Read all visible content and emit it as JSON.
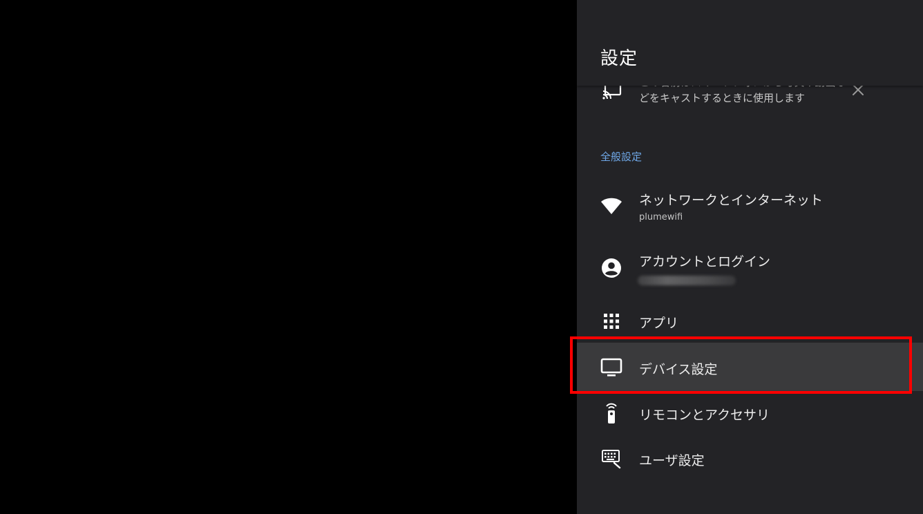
{
  "panel": {
    "title": "設定"
  },
  "cast_card": {
    "text": "この名前はスマートフォンから写真や動画などをキャストするときに使用します",
    "icon": "cast-icon",
    "close_icon": "close-icon"
  },
  "general_section": {
    "label": "全般設定"
  },
  "items": [
    {
      "label": "ネットワークとインターネット",
      "sub": "plumewifi",
      "icon": "wifi-icon"
    },
    {
      "label": "アカウントとログイン",
      "sub": "",
      "icon": "account-circle-icon"
    },
    {
      "label": "アプリ",
      "icon": "apps-grid-icon"
    },
    {
      "label": "デバイス設定",
      "icon": "tv-icon"
    },
    {
      "label": "リモコンとアクセサリ",
      "icon": "remote-icon"
    },
    {
      "label": "ユーザ設定",
      "icon": "keyboard-icon"
    }
  ],
  "colors": {
    "background": "#000000",
    "panel": "#232326",
    "focused_row": "#3a3a3c",
    "section_label": "#6fa8e8",
    "highlight": "#ff0000"
  }
}
